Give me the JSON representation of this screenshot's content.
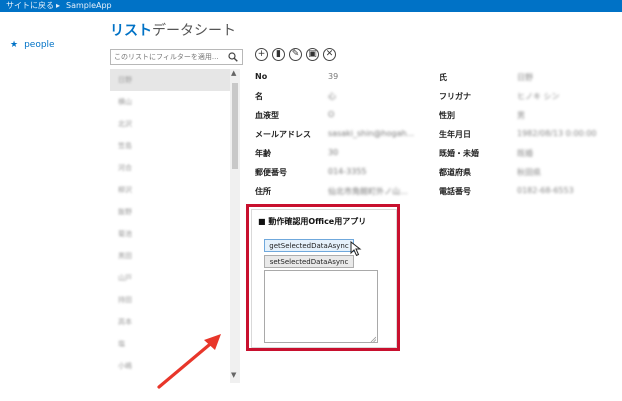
{
  "topbar": {
    "back_label": "サイトに戻る",
    "separator": "▸",
    "app_name": "SampleApp"
  },
  "leftnav": {
    "items": [
      {
        "label": "people",
        "icon": "star-icon"
      }
    ]
  },
  "tabs": {
    "list_label": "リスト",
    "datasheet_label": "データシート"
  },
  "filter": {
    "placeholder": "このリストにフィルターを適用...",
    "icon": "search-icon"
  },
  "actions": [
    {
      "name": "add-icon",
      "glyph": "+"
    },
    {
      "name": "delete-icon",
      "glyph": "▮"
    },
    {
      "name": "edit-icon",
      "glyph": "✎"
    },
    {
      "name": "save-icon",
      "glyph": "▣"
    },
    {
      "name": "cancel-icon",
      "glyph": "✕"
    }
  ],
  "list": {
    "items": [
      "日野",
      "横山",
      "北沢",
      "笠島",
      "河合",
      "柳沢",
      "飯野",
      "菊池",
      "黒田",
      "山戸",
      "持田",
      "高本",
      "塩",
      "小嶋"
    ],
    "selected_index": 0
  },
  "details": {
    "rows": [
      {
        "k1": "No",
        "v1": "39",
        "k2": "氏",
        "v2": "日野"
      },
      {
        "k1": "名",
        "v1": "心",
        "k2": "フリガナ",
        "v2": "ヒノキ シン"
      },
      {
        "k1": "血液型",
        "v1": "O",
        "k2": "性別",
        "v2": "男"
      },
      {
        "k1": "メールアドレス",
        "v1": "sasaki_shin@hogah...",
        "k2": "生年月日",
        "v2": "1982/08/13 0:00:00"
      },
      {
        "k1": "年齢",
        "v1": "30",
        "k2": "既婚・未婚",
        "v2": "既婚"
      },
      {
        "k1": "郵便番号",
        "v1": "014-3355",
        "k2": "都道府県",
        "v2": "秋田県"
      },
      {
        "k1": "住所",
        "v1": "仙北市角館町外ノ山...",
        "k2": "電話番号",
        "v2": "0182-68-6553"
      }
    ]
  },
  "app_panel": {
    "title": "■ 動作確認用Office用アプリ",
    "get_button": "getSelectedDataAsync",
    "set_button": "setSelectedDataAsync",
    "textarea_value": ""
  },
  "colors": {
    "topbar": "#0072c6",
    "accent": "#0072c6",
    "highlight_box": "#c8102e",
    "annotation_arrow": "#e8362a"
  }
}
